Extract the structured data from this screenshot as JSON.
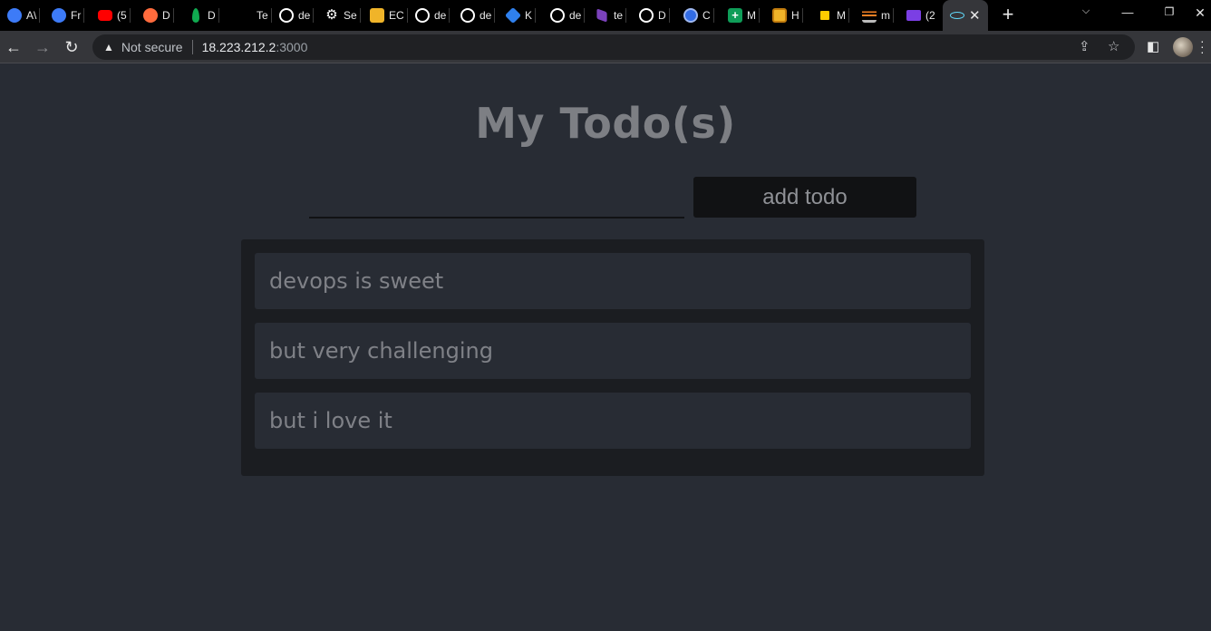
{
  "browser": {
    "tabs": [
      {
        "label": "A\\",
        "icon": "app-icon",
        "color": "#3d7bf7"
      },
      {
        "label": "Fr",
        "icon": "app-icon",
        "color": "#3d7bf7"
      },
      {
        "label": "(5",
        "icon": "youtube-icon",
        "color": "#ff0000"
      },
      {
        "label": "D",
        "icon": "app-icon",
        "color": "#ff6b3d"
      },
      {
        "label": "D",
        "icon": "mongodb-icon",
        "color": "#10aa50"
      },
      {
        "label": "Te",
        "icon": "",
        "color": "#000000"
      },
      {
        "label": "de",
        "icon": "github-icon",
        "color": "#ffffff"
      },
      {
        "label": "Se",
        "icon": "gear-icon",
        "color": "#ffffff"
      },
      {
        "label": "EC",
        "icon": "aws-icon",
        "color": "#f0b429"
      },
      {
        "label": "de",
        "icon": "github-icon",
        "color": "#ffffff"
      },
      {
        "label": "de",
        "icon": "github-icon",
        "color": "#ffffff"
      },
      {
        "label": "K",
        "icon": "app-icon",
        "color": "#2f80ed"
      },
      {
        "label": "de",
        "icon": "github-icon",
        "color": "#ffffff"
      },
      {
        "label": "te",
        "icon": "terraform-icon",
        "color": "#7b42bc"
      },
      {
        "label": "D",
        "icon": "github-icon",
        "color": "#ffffff"
      },
      {
        "label": "C",
        "icon": "kubernetes-icon",
        "color": "#326ce5"
      },
      {
        "label": "M",
        "icon": "sheets-icon",
        "color": "#0f9d58"
      },
      {
        "label": "H",
        "icon": "package-icon",
        "color": "#f0b429"
      },
      {
        "label": "M",
        "icon": "mtn-icon",
        "color": "#ffcc00"
      },
      {
        "label": "m",
        "icon": "stackoverflow-icon",
        "color": "#f48024"
      },
      {
        "label": "(2",
        "icon": "mail-icon",
        "color": "#7b3fe4"
      }
    ],
    "active_tab": {
      "icon": "react-icon",
      "color": "#61dafb"
    },
    "address": {
      "security_label": "Not secure",
      "host": "18.223.212.2",
      "port": ":3000"
    }
  },
  "app": {
    "title": "My Todo(s)",
    "input": {
      "value": "",
      "placeholder": ""
    },
    "add_button_label": "add todo",
    "todos": [
      {
        "text": "devops is sweet"
      },
      {
        "text": "but very challenging"
      },
      {
        "text": "but i love it"
      }
    ]
  },
  "colors": {
    "page_background": "#282c34",
    "panel_background": "#1b1d21",
    "button_background": "#111214",
    "text_muted": "#7d7f84"
  }
}
